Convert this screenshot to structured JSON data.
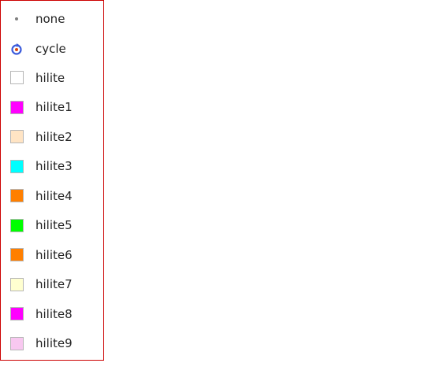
{
  "menu": {
    "border_color": "#cc0000",
    "items": [
      {
        "label": "none",
        "icon": "dot-icon"
      },
      {
        "label": "cycle",
        "icon": "cycle-icon"
      },
      {
        "label": "hilite",
        "icon": "swatch-icon",
        "color": "#ffffff"
      },
      {
        "label": "hilite1",
        "icon": "swatch-icon",
        "color": "#ff00ff"
      },
      {
        "label": "hilite2",
        "icon": "swatch-icon",
        "color": "#ffe4c4"
      },
      {
        "label": "hilite3",
        "icon": "swatch-icon",
        "color": "#00ffff"
      },
      {
        "label": "hilite4",
        "icon": "swatch-icon",
        "color": "#ff7f00"
      },
      {
        "label": "hilite5",
        "icon": "swatch-icon",
        "color": "#00ff00"
      },
      {
        "label": "hilite6",
        "icon": "swatch-icon",
        "color": "#ff7f00"
      },
      {
        "label": "hilite7",
        "icon": "swatch-icon",
        "color": "#ffffd0"
      },
      {
        "label": "hilite8",
        "icon": "swatch-icon",
        "color": "#ff00ff"
      },
      {
        "label": "hilite9",
        "icon": "swatch-icon",
        "color": "#f8c8f0"
      }
    ]
  }
}
